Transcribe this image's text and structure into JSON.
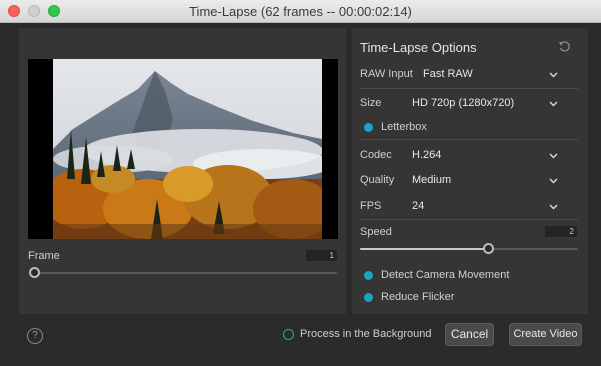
{
  "window": {
    "title": "Time-Lapse (62 frames -- 00:00:02:14)"
  },
  "frame": {
    "label": "Frame",
    "value": "1",
    "position_fraction": 0.0
  },
  "options": {
    "title": "Time-Lapse Options",
    "raw_input": {
      "label": "RAW Input",
      "value": "Fast RAW"
    },
    "size": {
      "label": "Size",
      "value": "HD 720p (1280x720)"
    },
    "letterbox": {
      "label": "Letterbox",
      "checked": true
    },
    "codec": {
      "label": "Codec",
      "value": "H.264"
    },
    "quality": {
      "label": "Quality",
      "value": "Medium"
    },
    "fps": {
      "label": "FPS",
      "value": "24"
    },
    "speed": {
      "label": "Speed",
      "value": "2",
      "position_fraction": 0.59
    },
    "detect_camera_movement": {
      "label": "Detect Camera Movement",
      "checked": true
    },
    "reduce_flicker": {
      "label": "Reduce Flicker",
      "checked": true
    }
  },
  "footer": {
    "help": "?",
    "process_background": {
      "label": "Process in the Background",
      "checked": false
    },
    "cancel_label": "Cancel",
    "create_label": "Create Video"
  },
  "colors": {
    "accent": "#1ca3c8",
    "panel": "#353535",
    "window": "#2b2b2b"
  },
  "icons": [
    "close-icon",
    "minimize-icon",
    "maximize-icon",
    "reset-icon",
    "chevron-down-icon",
    "help-icon"
  ]
}
